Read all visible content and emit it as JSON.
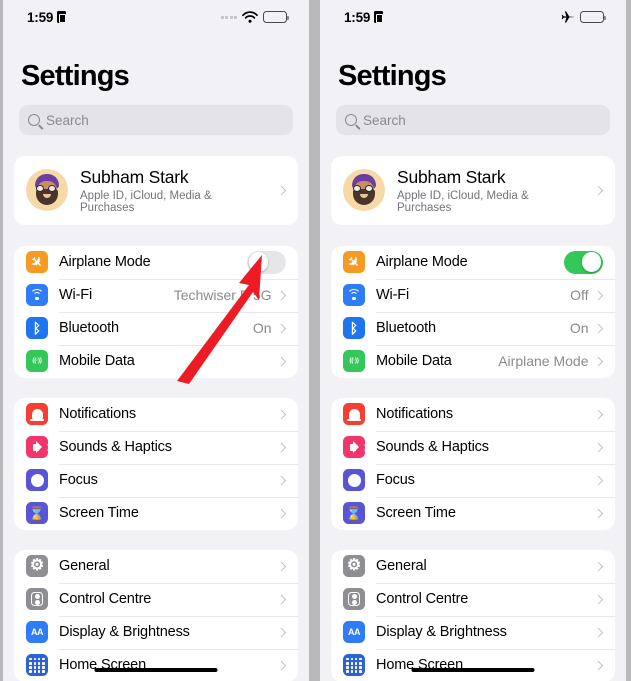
{
  "panels": [
    {
      "id": "before",
      "status_bar": {
        "time": "1:59",
        "lock_icon": "lock-portrait-icon",
        "signal_icon": "signal-dots-icon",
        "connectivity_icon": "wifi-icon",
        "battery_icon": "battery-icon"
      },
      "header": {
        "title": "Settings"
      },
      "search": {
        "placeholder": "Search",
        "icon": "search-icon"
      },
      "profile": {
        "name": "Subham  Stark",
        "subtitle": "Apple ID, iCloud, Media & Purchases",
        "avatar_icon": "memoji-avatar"
      },
      "groups": [
        {
          "id": "connectivity",
          "rows": [
            {
              "label": "Airplane Mode",
              "icon": "airplane-icon",
              "icon_color": "#f59a23",
              "control": "toggle",
              "toggle_on": false
            },
            {
              "label": "Wi-Fi",
              "icon": "wifi-icon",
              "icon_color": "#2e7cf6",
              "value": "Techwiser P 5G",
              "control": "chevron"
            },
            {
              "label": "Bluetooth",
              "icon": "bluetooth-icon",
              "icon_color": "#1f74f0",
              "value": "On",
              "control": "chevron"
            },
            {
              "label": "Mobile Data",
              "icon": "cellular-icon",
              "icon_color": "#34c759",
              "value": "",
              "control": "chevron"
            }
          ]
        },
        {
          "id": "alerts",
          "rows": [
            {
              "label": "Notifications",
              "icon": "bell-icon",
              "icon_color": "#f43f32",
              "value": "",
              "control": "chevron"
            },
            {
              "label": "Sounds & Haptics",
              "icon": "speaker-icon",
              "icon_color": "#f2366b",
              "value": "",
              "control": "chevron"
            },
            {
              "label": "Focus",
              "icon": "moon-icon",
              "icon_color": "#5856d6",
              "value": "",
              "control": "chevron"
            },
            {
              "label": "Screen Time",
              "icon": "hourglass-icon",
              "icon_color": "#5856d6",
              "value": "",
              "control": "chevron"
            }
          ]
        },
        {
          "id": "system",
          "rows": [
            {
              "label": "General",
              "icon": "gear-icon",
              "icon_color": "#8e8e93",
              "value": "",
              "control": "chevron"
            },
            {
              "label": "Control Centre",
              "icon": "control-centre-icon",
              "icon_color": "#8e8e93",
              "value": "",
              "control": "chevron"
            },
            {
              "label": "Display & Brightness",
              "icon": "display-brightness-icon",
              "icon_color": "#2e7cf6",
              "value": "",
              "control": "chevron"
            },
            {
              "label": "Home Screen",
              "icon": "home-screen-icon",
              "icon_color": "#2b62d9",
              "value": "",
              "control": "chevron"
            }
          ]
        }
      ]
    },
    {
      "id": "after",
      "status_bar": {
        "time": "1:59",
        "lock_icon": "lock-portrait-icon",
        "signal_icon": "",
        "connectivity_icon": "airplane-icon",
        "battery_icon": "battery-icon"
      },
      "header": {
        "title": "Settings"
      },
      "search": {
        "placeholder": "Search",
        "icon": "search-icon"
      },
      "profile": {
        "name": "Subham  Stark",
        "subtitle": "Apple ID, iCloud, Media & Purchases",
        "avatar_icon": "memoji-avatar"
      },
      "groups": [
        {
          "id": "connectivity",
          "rows": [
            {
              "label": "Airplane Mode",
              "icon": "airplane-icon",
              "icon_color": "#f59a23",
              "control": "toggle",
              "toggle_on": true
            },
            {
              "label": "Wi-Fi",
              "icon": "wifi-icon",
              "icon_color": "#2e7cf6",
              "value": "Off",
              "control": "chevron"
            },
            {
              "label": "Bluetooth",
              "icon": "bluetooth-icon",
              "icon_color": "#1f74f0",
              "value": "On",
              "control": "chevron"
            },
            {
              "label": "Mobile Data",
              "icon": "cellular-icon",
              "icon_color": "#34c759",
              "value": "Airplane Mode",
              "control": "chevron"
            }
          ]
        },
        {
          "id": "alerts",
          "rows": [
            {
              "label": "Notifications",
              "icon": "bell-icon",
              "icon_color": "#f43f32",
              "value": "",
              "control": "chevron"
            },
            {
              "label": "Sounds & Haptics",
              "icon": "speaker-icon",
              "icon_color": "#f2366b",
              "value": "",
              "control": "chevron"
            },
            {
              "label": "Focus",
              "icon": "moon-icon",
              "icon_color": "#5856d6",
              "value": "",
              "control": "chevron"
            },
            {
              "label": "Screen Time",
              "icon": "hourglass-icon",
              "icon_color": "#5856d6",
              "value": "",
              "control": "chevron"
            }
          ]
        },
        {
          "id": "system",
          "rows": [
            {
              "label": "General",
              "icon": "gear-icon",
              "icon_color": "#8e8e93",
              "value": "",
              "control": "chevron"
            },
            {
              "label": "Control Centre",
              "icon": "control-centre-icon",
              "icon_color": "#8e8e93",
              "value": "",
              "control": "chevron"
            },
            {
              "label": "Display & Brightness",
              "icon": "display-brightness-icon",
              "icon_color": "#2e7cf6",
              "value": "",
              "control": "chevron"
            },
            {
              "label": "Home Screen",
              "icon": "home-screen-icon",
              "icon_color": "#2b62d9",
              "value": "",
              "control": "chevron"
            }
          ]
        }
      ]
    }
  ],
  "annotation": {
    "type": "arrow",
    "color": "#ed1c24",
    "points_to": "airplane-mode-toggle"
  }
}
